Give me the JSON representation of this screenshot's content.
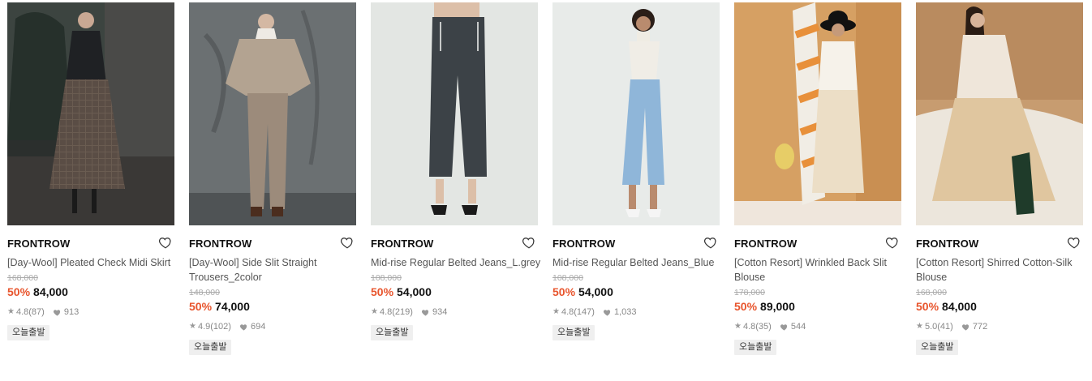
{
  "products": [
    {
      "brand": "FRONTROW",
      "name": "[Day-Wool] Pleated Check Midi Skirt",
      "original_price": "168,000",
      "discount": "50%",
      "price": "84,000",
      "rating": "4.8",
      "reviews": "(87)",
      "likes": "913",
      "badge": "오늘출발",
      "photo_bg": "#2f3331",
      "wishlist_icon": "heart-outline-icon"
    },
    {
      "brand": "FRONTROW",
      "name": "[Day-Wool] Side Slit Straight Trousers_2color",
      "original_price": "148,000",
      "discount": "50%",
      "price": "74,000",
      "rating": "4.9",
      "reviews": "(102)",
      "likes": "694",
      "badge": "오늘출발",
      "photo_bg": "#6d7173",
      "wishlist_icon": "heart-outline-icon"
    },
    {
      "brand": "FRONTROW",
      "name": "Mid-rise Regular Belted Jeans_L.grey",
      "original_price": "108,000",
      "discount": "50%",
      "price": "54,000",
      "rating": "4.8",
      "reviews": "(219)",
      "likes": "934",
      "badge": "오늘출발",
      "photo_bg": "#e4e7e4",
      "wishlist_icon": "heart-outline-icon"
    },
    {
      "brand": "FRONTROW",
      "name": "Mid-rise Regular Belted Jeans_Blue",
      "original_price": "108,000",
      "discount": "50%",
      "price": "54,000",
      "rating": "4.8",
      "reviews": "(147)",
      "likes": "1,033",
      "badge": "오늘출발",
      "photo_bg": "#e9ecea",
      "wishlist_icon": "heart-outline-icon"
    },
    {
      "brand": "FRONTROW",
      "name": "[Cotton Resort] Wrinkled Back Slit Blouse",
      "original_price": "178,000",
      "discount": "50%",
      "price": "89,000",
      "rating": "4.8",
      "reviews": "(35)",
      "likes": "544",
      "badge": "오늘출발",
      "photo_bg": "#d9a266",
      "wishlist_icon": "heart-outline-icon"
    },
    {
      "brand": "FRONTROW",
      "name": "[Cotton Resort] Shirred Cotton-Silk Blouse",
      "original_price": "168,000",
      "discount": "50%",
      "price": "84,000",
      "rating": "5.0",
      "reviews": "(41)",
      "likes": "772",
      "badge": "오늘출발",
      "photo_bg": "#c9a27a",
      "wishlist_icon": "heart-outline-icon"
    }
  ],
  "colors": {
    "discount": "#e8552d",
    "brand_text": "#111111",
    "name_text": "#555555",
    "badge_bg": "#efefef"
  }
}
